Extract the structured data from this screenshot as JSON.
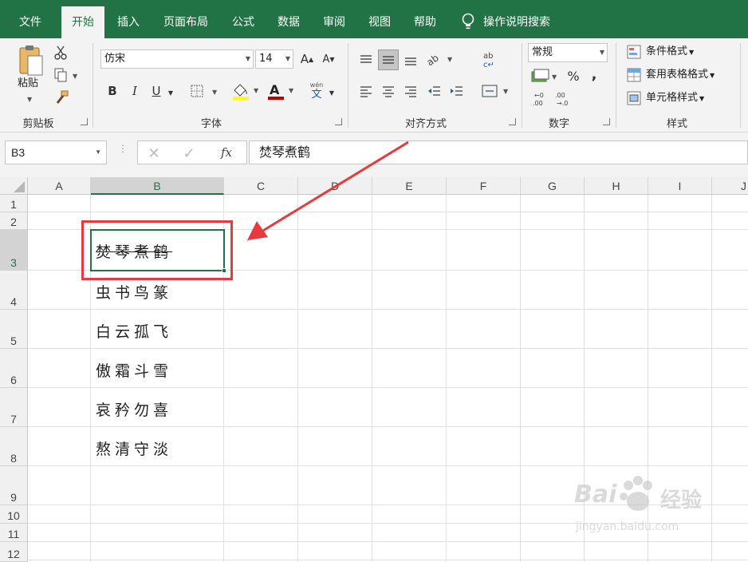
{
  "tabs": [
    "文件",
    "开始",
    "插入",
    "页面布局",
    "公式",
    "数据",
    "审阅",
    "视图",
    "帮助"
  ],
  "tell_me": "操作说明搜索",
  "clipboard": {
    "paste_label": "粘贴",
    "group_label": "剪贴板"
  },
  "font": {
    "name": "仿宋",
    "size": "14",
    "group_label": "字体",
    "bold": "B",
    "italic": "I",
    "underline": "U",
    "wen": "wén",
    "wen_char": "文"
  },
  "alignment": {
    "group_label": "对齐方式"
  },
  "number": {
    "format": "常规",
    "group_label": "数字",
    "percent": "%",
    "comma": ","
  },
  "styles": {
    "conditional": "条件格式",
    "table": "套用表格格式",
    "cell": "单元格样式",
    "group_label": "样式"
  },
  "formula_bar": {
    "name_box": "B3",
    "fx": "fx",
    "content": "焚琴煮鹤"
  },
  "columns": [
    "A",
    "B",
    "C",
    "D",
    "E",
    "F",
    "G",
    "H",
    "I",
    "J"
  ],
  "rows": [
    "1",
    "2",
    "3",
    "4",
    "5",
    "6",
    "7",
    "8",
    "9",
    "10",
    "11",
    "12"
  ],
  "cells": [
    "焚琴煮鹤",
    "虫书鸟篆",
    "白云孤飞",
    "傲霜斗雪",
    "哀矜勿喜",
    "熬清守淡"
  ],
  "selected_cell": "B3",
  "watermark": {
    "brand": "Bai",
    "sub": "jingyan.baidu.com",
    "cn": "经验"
  },
  "colors": {
    "accent": "#217346",
    "annotation": "#e8393c"
  }
}
